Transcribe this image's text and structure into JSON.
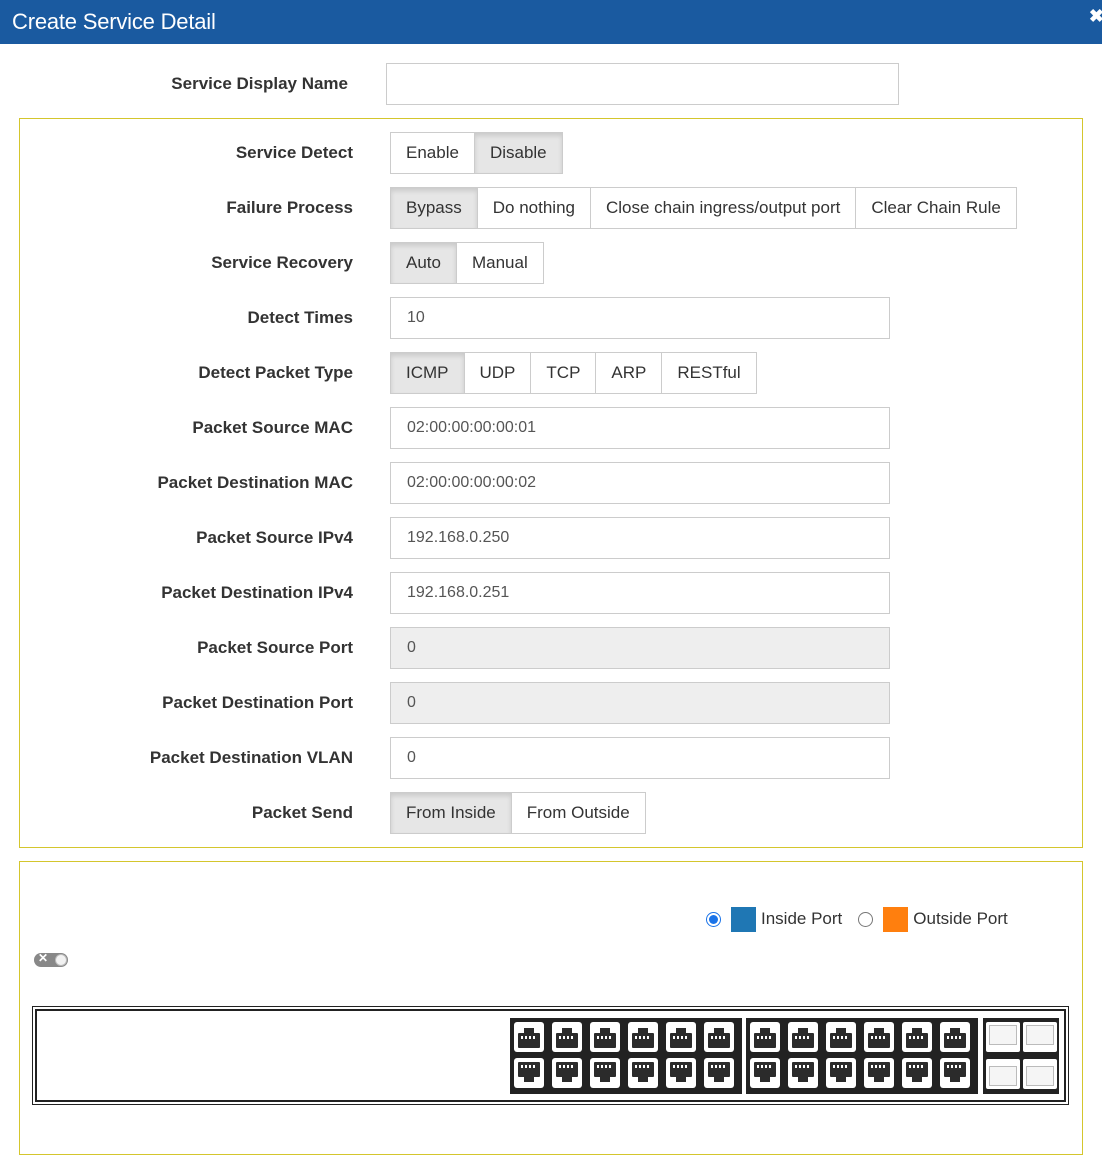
{
  "dialog": {
    "title": "Create Service Detail",
    "close_glyph": "✖"
  },
  "display_name": {
    "label": "Service Display Name",
    "value": "",
    "placeholder": ""
  },
  "service_detect": {
    "label": "Service Detect",
    "options": [
      "Enable",
      "Disable"
    ],
    "selected": "Disable"
  },
  "failure_process": {
    "label": "Failure Process",
    "options": [
      "Bypass",
      "Do nothing",
      "Close chain ingress/output port",
      "Clear Chain Rule"
    ],
    "selected": "Bypass"
  },
  "service_recovery": {
    "label": "Service Recovery",
    "options": [
      "Auto",
      "Manual"
    ],
    "selected": "Auto"
  },
  "detect_times": {
    "label": "Detect Times",
    "value": "10"
  },
  "detect_packet_type": {
    "label": "Detect Packet Type",
    "options": [
      "ICMP",
      "UDP",
      "TCP",
      "ARP",
      "RESTful"
    ],
    "selected": "ICMP"
  },
  "packet_source_mac": {
    "label": "Packet Source MAC",
    "value": "02:00:00:00:00:01"
  },
  "packet_destination_mac": {
    "label": "Packet Destination MAC",
    "value": "02:00:00:00:00:02"
  },
  "packet_source_ipv4": {
    "label": "Packet Source IPv4",
    "value": "192.168.0.250"
  },
  "packet_destination_ipv4": {
    "label": "Packet Destination IPv4",
    "value": "192.168.0.251"
  },
  "packet_source_port": {
    "label": "Packet Source Port",
    "value": "0",
    "disabled": true
  },
  "packet_destination_port": {
    "label": "Packet Destination Port",
    "value": "0",
    "disabled": true
  },
  "packet_destination_vlan": {
    "label": "Packet Destination VLAN",
    "value": "0"
  },
  "packet_send": {
    "label": "Packet Send",
    "options": [
      "From Inside",
      "From Outside"
    ],
    "selected": "From Inside"
  },
  "port_legend": {
    "inside": {
      "label": "Inside Port",
      "color": "#1f77b4",
      "checked": true
    },
    "outside": {
      "label": "Outside Port",
      "color": "#ff7f0e",
      "checked": false
    }
  },
  "switch_panel": {
    "rj45_groups": 2,
    "ports_per_group_row": 6,
    "sfp_ports": 4
  },
  "colors": {
    "header": "#1a5aa0",
    "section_border": "#d4c62d"
  }
}
